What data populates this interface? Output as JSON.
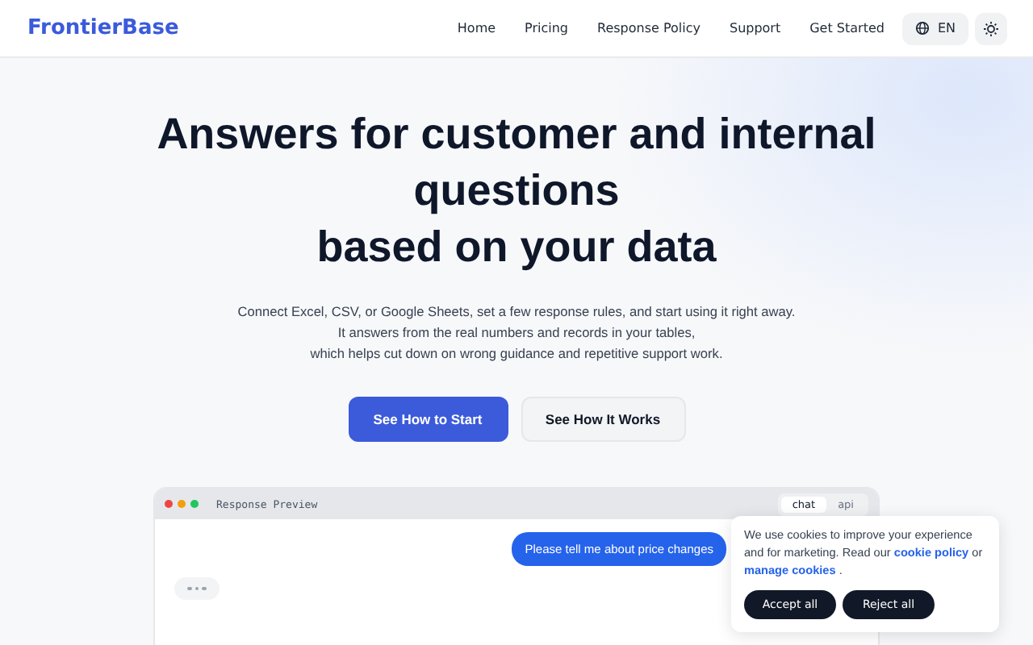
{
  "header": {
    "logo": "FrontierBase",
    "nav": [
      {
        "label": "Home"
      },
      {
        "label": "Pricing"
      },
      {
        "label": "Response Policy"
      },
      {
        "label": "Support"
      },
      {
        "label": "Get Started"
      }
    ],
    "language": "EN"
  },
  "hero": {
    "title_lines": [
      "Answers for customer and internal",
      "questions",
      "based on your data"
    ],
    "description_lines": [
      "Connect Excel, CSV, or Google Sheets, set a few response rules, and start using it right away.",
      "It answers from the real numbers and records in your tables,",
      "which helps cut down on wrong guidance and repetitive support work."
    ],
    "buttons": [
      {
        "label": "See How to Start",
        "kind": "primary"
      },
      {
        "label": "See How It Works",
        "kind": "secondary"
      }
    ]
  },
  "preview": {
    "title": "Response Preview",
    "tabs": [
      {
        "label": "chat",
        "selected": true
      },
      {
        "label": "api",
        "selected": false
      }
    ],
    "user_message": "Please tell me about price changes"
  },
  "cookie_banner": {
    "text_before": "We use cookies to improve your experience and for marketing. Read our",
    "policy_link": "cookie policy",
    "text_middle": "or",
    "manage_link": "manage cookies",
    "text_after": ".",
    "buttons": [
      {
        "label": "Accept all"
      },
      {
        "label": "Reject all"
      }
    ]
  }
}
